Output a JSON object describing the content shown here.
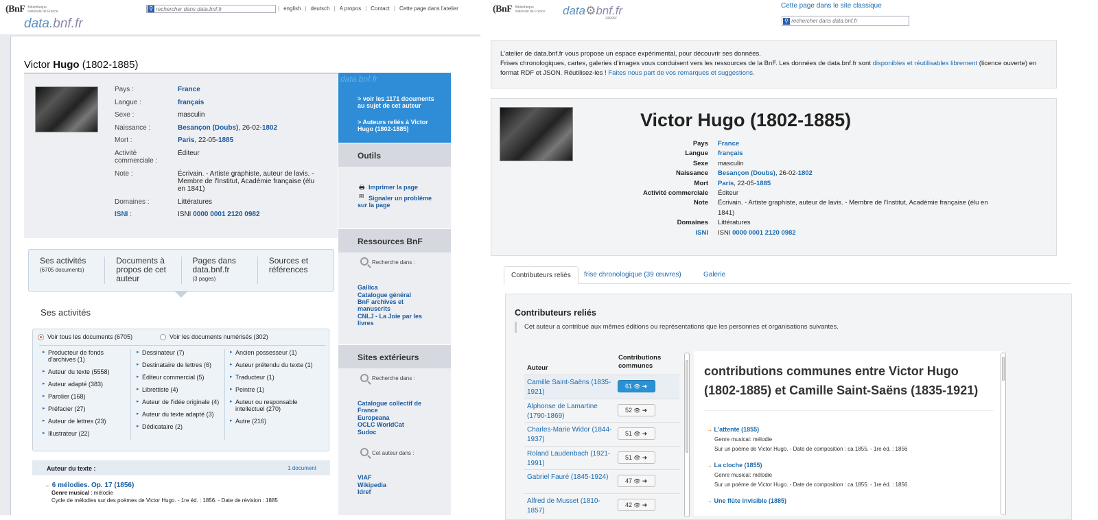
{
  "left": {
    "bnf_logo": "(BnF",
    "bnf_sub": "Bibliothèque nationale de France",
    "search_placeholder": "rechercher dans data.bnf.fr",
    "toplinks": [
      "english",
      "deutsch",
      "A propos",
      "Contact",
      "Cette page dans l'atelier"
    ],
    "data_logo_a": "data",
    "data_logo_b": ".bnf.fr",
    "name_first": "Victor ",
    "name_last": "Hugo",
    "name_dates": " (1802-1885)",
    "facts": {
      "pays_label": "Pays :",
      "pays": "France",
      "langue_label": "Langue :",
      "langue": "français",
      "sexe_label": "Sexe :",
      "sexe": "masculin",
      "naissance_label": "Naissance :",
      "naissance_place": "Besançon (Doubs)",
      "naissance_date": ", 26-02-",
      "naissance_year": "1802",
      "mort_label": "Mort :",
      "mort_place": "Paris",
      "mort_date": ", 22-05-",
      "mort_year": "1885",
      "activite_label": "Activité commerciale :",
      "activite": "Éditeur",
      "note_label": "Note :",
      "note": "Écrivain. - Artiste graphiste, auteur de lavis. - Membre de l'Institut, Académie française (élu en 1841)",
      "domaines_label": "Domaines :",
      "domaines": "Littératures",
      "isni_label": "ISNI",
      "isni_colon": " :",
      "isni_prefix": "ISNI ",
      "isni": "0000 0001 2120 0982"
    },
    "bluebox": {
      "watermark": "data.bnf.fr",
      "link1": "> voir les 1171 documents au sujet de cet auteur",
      "link2": "> Auteurs reliés à Victor Hugo (1802-1885)"
    },
    "outils": {
      "title": "Outils",
      "print": "Imprimer la page",
      "report": "Signaler un problème sur la page"
    },
    "ressources": {
      "title": "Ressources BnF",
      "search_in": "Recherche dans :",
      "links": [
        "Gallica",
        "Catalogue général",
        "BnF archives et manuscrits",
        "CNLJ - La Joie par les livres"
      ]
    },
    "sites": {
      "title": "Sites extérieurs",
      "search_in": "Recherche dans :",
      "links": [
        "Catalogue collectif de France",
        "Europeana",
        "OCLC WorldCat",
        "Sudoc"
      ],
      "author_in": "Cet auteur dans :",
      "author_links": [
        "VIAF",
        "Wikipedia",
        "Idref"
      ]
    },
    "tabs": [
      {
        "label": "Ses activités",
        "sub": "(6705 documents)"
      },
      {
        "label": "Documents à propos de cet auteur",
        "sub": ""
      },
      {
        "label": "Pages dans data.bnf.fr",
        "sub": "(3 pages)"
      },
      {
        "label": "Sources et références",
        "sub": ""
      }
    ],
    "section_title": "Ses activités",
    "radio_all": "Voir tous les documents (6705)",
    "radio_digital": "Voir les documents numérisés (302)",
    "filters_col1": [
      "Producteur de fonds d'archives (1)",
      "Auteur du texte (5558)",
      "Auteur adapté (383)",
      "Parolier (168)",
      "Préfacier (27)",
      "Auteur de lettres (23)",
      "Illustrateur (22)"
    ],
    "filters_col2": [
      "Dessinateur (7)",
      "Destinataire de lettres (6)",
      "Éditeur commercial (5)",
      "Librettiste (4)",
      "Auteur de l'idée originale (4)",
      "Auteur du texte adapté (3)",
      "Dédicataire (2)"
    ],
    "filters_col3": [
      "Ancien possesseur (1)",
      "Auteur prétendu du texte (1)",
      "Traducteur (1)",
      "Peintre (1)",
      "Auteur ou responsable intellectuel (270)",
      "Autre (216)"
    ],
    "result_head": "Auteur du texte :",
    "result_count": "1 document",
    "result_title": "6 mélodies. Op. 17 (1856)",
    "result_genre_label": "Genre musical",
    "result_genre": " : mélodie",
    "result_desc": "Cycle de mélodies sur des poèmes de Victor Hugo. - 1re éd. : 1856. - Date de révision : 1885"
  },
  "right": {
    "bnf_logo": "(BnF",
    "bnf_sub": "Bibliothèque nationale de France",
    "data_logo_a": "data",
    "data_logo_b": "bnf.fr",
    "atelier": "Atelier",
    "classic_link": "Cette page dans le site classique",
    "search_placeholder": "rechercher dans data.bnf.fr",
    "intro_1": "L'atelier de data.bnf.fr vous propose un espace expérimental, pour découvrir ses données.",
    "intro_2": "Frises chronologiques, cartes, galeries d'images vous conduisent vers les ressources de la BnF. Les données de data.bnf.fr sont ",
    "intro_link1": "disponibles et réutilisables librement",
    "intro_3": " (licence ouverte) en format RDF et JSON. Réutilisez-les ! ",
    "intro_link2": "Faites nous part de vos remarques et suggestions.",
    "big_name": "Victor Hugo (1802-1885)",
    "facts": {
      "pays_label": "Pays",
      "pays": "France",
      "langue_label": "Langue",
      "langue": "français",
      "sexe_label": "Sexe",
      "sexe": "masculin",
      "naissance_label": "Naissance",
      "naissance_place": "Besançon (Doubs)",
      "naissance_date": ", 26-02-",
      "naissance_year": "1802",
      "mort_label": "Mort",
      "mort_place": "Paris",
      "mort_date": ", 22-05-",
      "mort_year": "1885",
      "activite_label": "Activité commerciale",
      "activite": "Éditeur",
      "note_label": "Note",
      "note": "Écrivain. - Artiste graphiste, auteur de lavis. - Membre de l'Institut, Académie française (élu en 1841)",
      "domaines_label": "Domaines",
      "domaines": "Littératures",
      "isni_label": "ISNI",
      "isni_prefix": "ISNI ",
      "isni": "0000 0001 2120 0982"
    },
    "tabs": [
      "Contributeurs reliés",
      "frise chronologique (39 œuvres)",
      "Galerie"
    ],
    "contrib_title": "Contributeurs reliés",
    "contrib_desc": "Cet auteur a contribué aux mêmes éditions ou représentations que les personnes et organisations suivantes.",
    "col_author": "Auteur",
    "col_contrib": "Contributions communes",
    "contributors": [
      {
        "name": "Camille Saint-Saëns (1835-1921)",
        "count": "61"
      },
      {
        "name": "Alphonse de Lamartine (1790-1869)",
        "count": "52"
      },
      {
        "name": "Charles-Marie Widor (1844-1937)",
        "count": "51"
      },
      {
        "name": "Roland Laudenbach (1921-1991)",
        "count": "51"
      },
      {
        "name": "Gabriel Fauré (1845-1924)",
        "count": "47"
      },
      {
        "name": "Alfred de Musset (1810-1857)",
        "count": "42"
      }
    ],
    "detail_title": "contributions communes entre Victor Hugo (1802-1885) et Camille Saint-Saëns (1835-1921)",
    "works": [
      {
        "title": "L'attente (1855)",
        "genre": "Genre musical: mélodie",
        "note": "Sur un poème de Victor Hugo. - Date de composition : ca 1855. - 1re éd. : 1856"
      },
      {
        "title": "La cloche (1855)",
        "genre": "Genre musical: mélodie",
        "note": "Sur un poème de Victor Hugo. - Date de composition : ca 1855. - 1re éd. : 1856"
      },
      {
        "title": "Une flûte invisible (1885)",
        "genre": "",
        "note": ""
      }
    ]
  }
}
